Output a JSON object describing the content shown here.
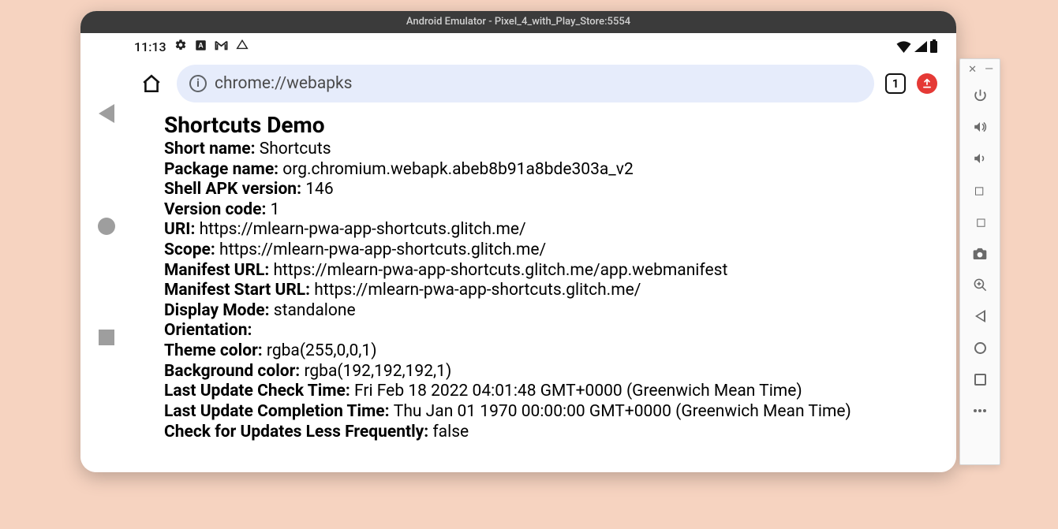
{
  "window": {
    "title": "Android Emulator - Pixel_4_with_Play_Store:5554"
  },
  "statusbar": {
    "time": "11:13"
  },
  "browser": {
    "url": "chrome://webapks",
    "tab_count": "1"
  },
  "page": {
    "title": "Shortcuts Demo",
    "fields": [
      {
        "label": "Short name:",
        "value": "Shortcuts"
      },
      {
        "label": "Package name:",
        "value": "org.chromium.webapk.abeb8b91a8bde303a_v2"
      },
      {
        "label": "Shell APK version:",
        "value": "146"
      },
      {
        "label": "Version code:",
        "value": "1"
      },
      {
        "label": "URI:",
        "value": "https://mlearn-pwa-app-shortcuts.glitch.me/"
      },
      {
        "label": "Scope:",
        "value": "https://mlearn-pwa-app-shortcuts.glitch.me/"
      },
      {
        "label": "Manifest URL:",
        "value": "https://mlearn-pwa-app-shortcuts.glitch.me/app.webmanifest"
      },
      {
        "label": "Manifest Start URL:",
        "value": "https://mlearn-pwa-app-shortcuts.glitch.me/"
      },
      {
        "label": "Display Mode:",
        "value": "standalone"
      },
      {
        "label": "Orientation:",
        "value": ""
      },
      {
        "label": "Theme color:",
        "value": "rgba(255,0,0,1)"
      },
      {
        "label": "Background color:",
        "value": "rgba(192,192,192,1)"
      },
      {
        "label": "Last Update Check Time:",
        "value": "Fri Feb 18 2022 04:01:48 GMT+0000 (Greenwich Mean Time)"
      },
      {
        "label": "Last Update Completion Time:",
        "value": "Thu Jan 01 1970 00:00:00 GMT+0000 (Greenwich Mean Time)"
      },
      {
        "label": "Check for Updates Less Frequently:",
        "value": "false"
      }
    ]
  }
}
